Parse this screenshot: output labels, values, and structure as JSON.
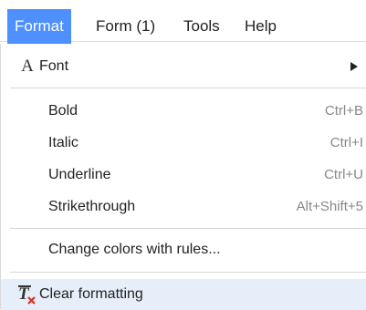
{
  "menubar": {
    "items": [
      {
        "label": "Format",
        "active": true
      },
      {
        "label": "Form (1)"
      },
      {
        "label": "Tools"
      },
      {
        "label": "Help"
      }
    ]
  },
  "menu": {
    "font": {
      "label": "Font",
      "icon": "font-icon",
      "submenu_icon": "triangle-right-icon"
    },
    "bold": {
      "label": "Bold",
      "shortcut": "Ctrl+B"
    },
    "italic": {
      "label": "Italic",
      "shortcut": "Ctrl+I"
    },
    "underline": {
      "label": "Underline",
      "shortcut": "Ctrl+U"
    },
    "strikethrough": {
      "label": "Strikethrough",
      "shortcut": "Alt+Shift+5"
    },
    "change_colors": {
      "label": "Change colors with rules..."
    },
    "clear_formatting": {
      "label": "Clear formatting",
      "icon": "clear-formatting-icon",
      "highlighted": true
    }
  },
  "colors": {
    "accent": "#4d90fe",
    "highlight": "#e6eef9",
    "shortcut_text": "#888888"
  }
}
